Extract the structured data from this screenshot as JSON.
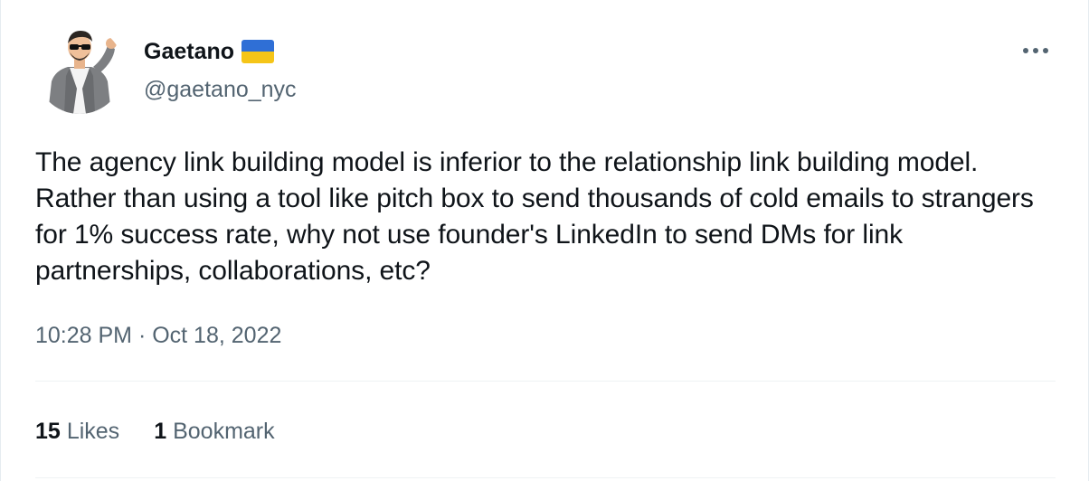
{
  "author": {
    "display_name": "Gaetano",
    "flag_icon": "ukraine-flag-icon",
    "flag_colors": [
      "#2f6fd6",
      "#f5c518"
    ],
    "handle": "@gaetano_nyc"
  },
  "tweet": {
    "text": "The agency link building model is inferior to the relationship link building model. Rather than using a tool like pitch box to send thousands of cold emails to strangers for 1% success rate, why not use founder's LinkedIn to send DMs for link partnerships, collaborations, etc?",
    "timestamp": "10:28 PM · Oct 18, 2022"
  },
  "stats": {
    "likes_count": "15",
    "likes_label": "Likes",
    "bookmarks_count": "1",
    "bookmarks_label": "Bookmark"
  },
  "menu": {
    "icon": "more-options-icon"
  }
}
